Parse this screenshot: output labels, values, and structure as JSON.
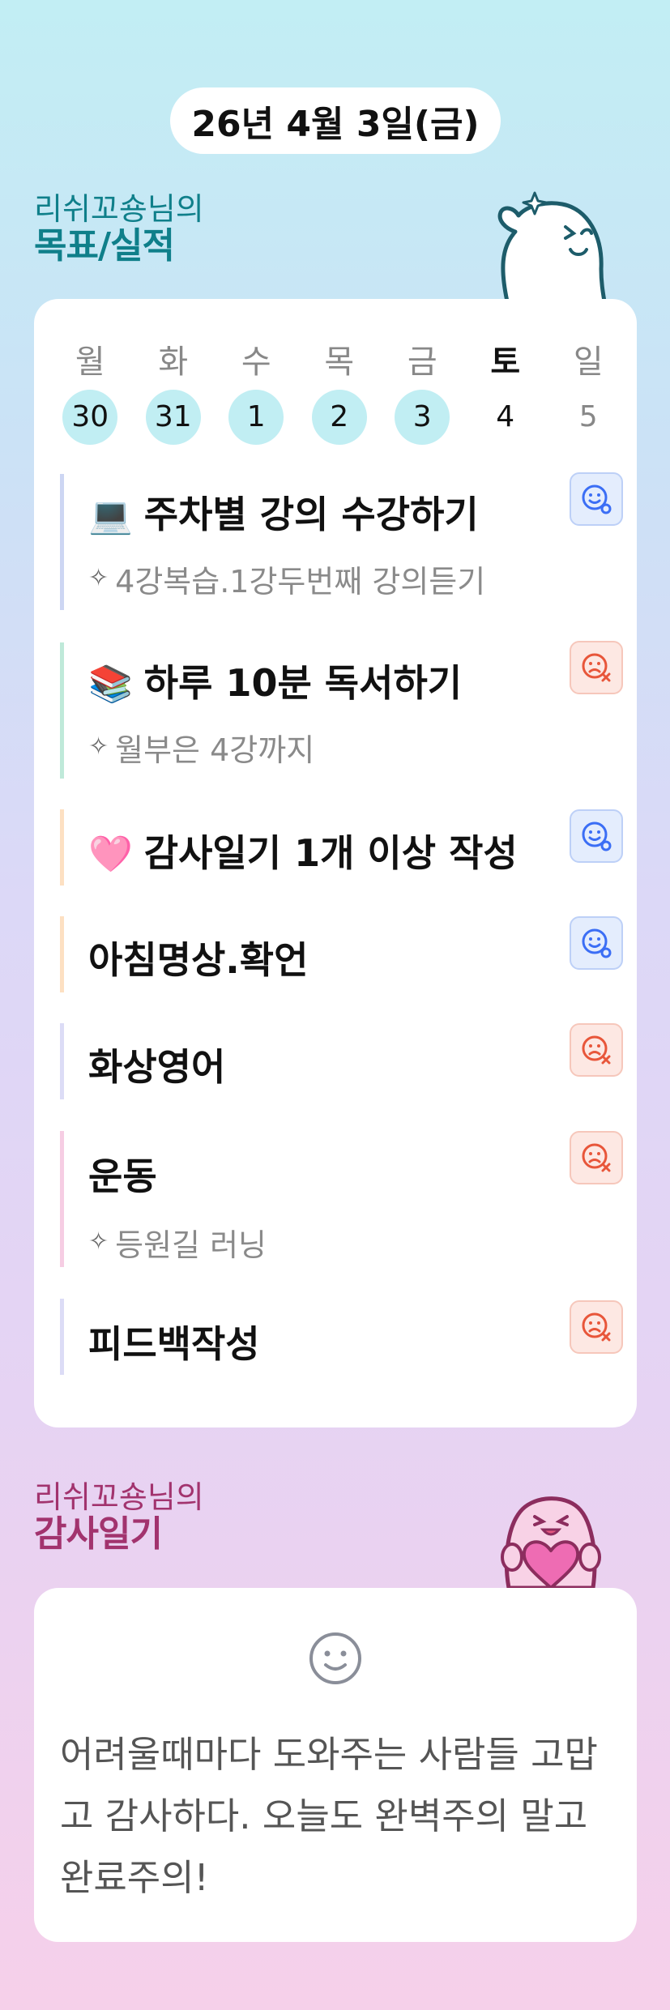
{
  "header": {
    "date": "26년 4월 3일(금)"
  },
  "goals_section": {
    "title_top": "리쉬꼬숑님의",
    "title_bottom": "목표/실적"
  },
  "week": [
    {
      "dow": "월",
      "num": "30",
      "done": true
    },
    {
      "dow": "화",
      "num": "31",
      "done": true
    },
    {
      "dow": "수",
      "num": "1",
      "done": true
    },
    {
      "dow": "목",
      "num": "2",
      "done": true
    },
    {
      "dow": "금",
      "num": "3",
      "done": true
    },
    {
      "dow": "토",
      "num": "4",
      "done": false,
      "today": true
    },
    {
      "dow": "일",
      "num": "5",
      "done": false
    }
  ],
  "goals": [
    {
      "emoji": "💻",
      "name": "주차별 강의 수강하기",
      "memo": "4강복습.1강두번째 강의듣기",
      "status": "achieved",
      "bar_color": "#cdd6f3"
    },
    {
      "emoji": "📚",
      "name": "하루 10분 독서하기",
      "memo": "월부은 4강까지",
      "status": "missed",
      "bar_color": "#bfe9d9"
    },
    {
      "emoji": "🩷",
      "name": "감사일기 1개 이상 작성",
      "memo": "",
      "status": "achieved",
      "bar_color": "#fde0c2"
    },
    {
      "emoji": "",
      "name": "아침명상.확언",
      "memo": "",
      "status": "achieved",
      "bar_color": "#fde0c2"
    },
    {
      "emoji": "",
      "name": "화상영어",
      "memo": "",
      "status": "missed",
      "bar_color": "#dcdcf6"
    },
    {
      "emoji": "",
      "name": "운동",
      "memo": "등원길 러닝",
      "status": "missed",
      "bar_color": "#f6cde3"
    },
    {
      "emoji": "",
      "name": "피드백작성",
      "memo": "",
      "status": "missed",
      "bar_color": "#dcdcf6"
    }
  ],
  "diary_section": {
    "title_top": "리쉬꼬숑님의",
    "title_bottom": "감사일기"
  },
  "diary": {
    "mood_icon": "smile-icon",
    "text": "어려울때마다 도와주는 사람들 고맙고 감사하다. 오늘도 완벽주의 말고 완료주의!"
  },
  "colors": {
    "achieved": "#3b6ef5",
    "missed": "#e8563a",
    "goal_title": "#0f7f8a",
    "diary_title": "#a2336e",
    "week_done": "#c1eef3"
  }
}
